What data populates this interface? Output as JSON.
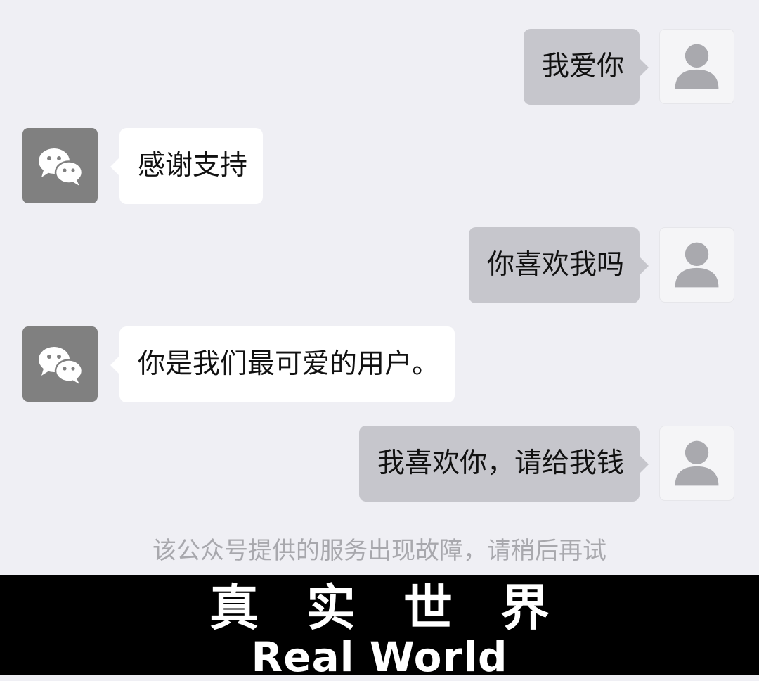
{
  "messages": [
    {
      "side": "sent",
      "text": "我爱你",
      "avatar_icon": "default-user-icon"
    },
    {
      "side": "recv",
      "text": "感谢支持",
      "avatar_icon": "wechat-logo-icon"
    },
    {
      "side": "sent",
      "text": "你喜欢我吗",
      "avatar_icon": "default-user-icon"
    },
    {
      "side": "recv",
      "text": "你是我们最可爱的用户。",
      "avatar_icon": "wechat-logo-icon"
    },
    {
      "side": "sent",
      "text": "我喜欢你，请给我钱",
      "avatar_icon": "default-user-icon"
    }
  ],
  "system_notice": "该公众号提供的服务出现故障，请稍后再试",
  "caption": {
    "cn_chars": [
      "真",
      "实",
      "世",
      "界"
    ],
    "en": "Real World"
  },
  "colors": {
    "chat_background": "#efeff4",
    "sent_bubble": "#c6c6cc",
    "received_bubble": "#ffffff",
    "caption_background": "#000000"
  }
}
